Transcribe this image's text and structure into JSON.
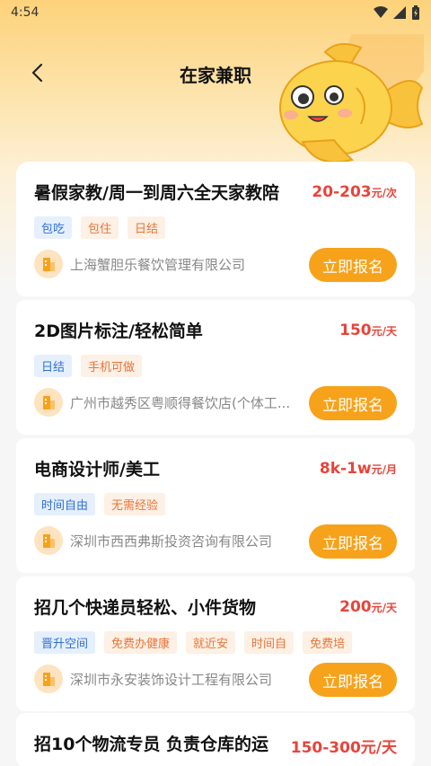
{
  "status_bar": {
    "time": "4:54"
  },
  "header": {
    "title": "在家兼职"
  },
  "jobs": [
    {
      "title": "暑假家教/周一到周六全天家教陪",
      "salary": "20-203",
      "unit": "元/次",
      "tags": [
        {
          "label": "包吃",
          "color": "blue"
        },
        {
          "label": "包住",
          "color": "orange"
        },
        {
          "label": "日结",
          "color": "orange"
        }
      ],
      "company": "上海蟹胆乐餐饮管理有限公司",
      "apply_label": "立即报名"
    },
    {
      "title": "2D图片标注/轻松简单",
      "salary": "150",
      "unit": "元/天",
      "tags": [
        {
          "label": "日结",
          "color": "blue"
        },
        {
          "label": "手机可做",
          "color": "orange"
        }
      ],
      "company": "广州市越秀区粤顺得餐饮店(个体工...",
      "apply_label": "立即报名"
    },
    {
      "title": "电商设计师/美工",
      "salary": "8k-1w",
      "unit": "元/月",
      "tags": [
        {
          "label": "时间自由",
          "color": "blue"
        },
        {
          "label": "无需经验",
          "color": "orange"
        }
      ],
      "company": "深圳市西西弗斯投资咨询有限公司",
      "apply_label": "立即报名"
    },
    {
      "title": "招几个快递员轻松、小件货物",
      "salary": "200",
      "unit": "元/天",
      "tags": [
        {
          "label": "晋升空间",
          "color": "blue"
        },
        {
          "label": "免费办健康",
          "color": "orange"
        },
        {
          "label": "就近安",
          "color": "orange"
        },
        {
          "label": "时间自",
          "color": "orange"
        },
        {
          "label": "免费培",
          "color": "orange"
        }
      ],
      "company": "深圳市永安装饰设计工程有限公司",
      "apply_label": "立即报名"
    }
  ],
  "partial_job": {
    "title": "招10个物流专员 负责仓库的运",
    "salary": "150-300元/天"
  },
  "colors": {
    "accent": "#f7a21b",
    "salary": "#e8443a"
  }
}
